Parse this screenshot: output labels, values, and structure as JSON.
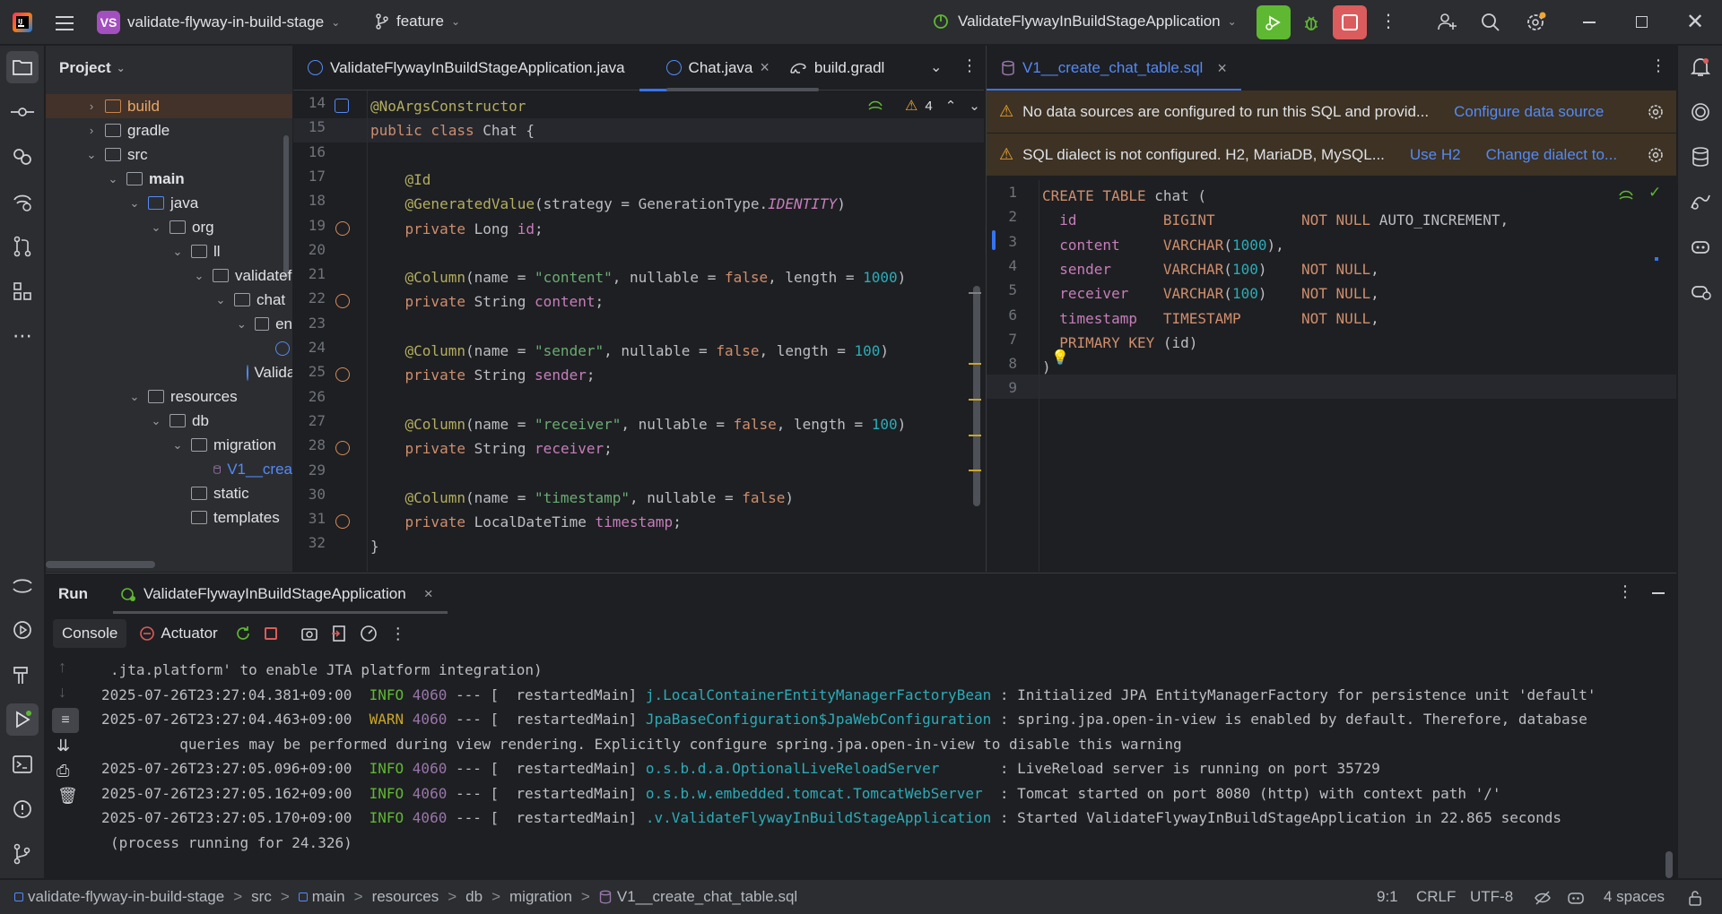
{
  "titlebar": {
    "project_initials": "VS",
    "project_name": "validate-flyway-in-build-stage",
    "branch": "feature",
    "run_config": "ValidateFlywayInBuildStageApplication"
  },
  "project_panel": {
    "title": "Project",
    "tree": [
      {
        "label": "build",
        "depth": 1
      },
      {
        "label": "gradle",
        "depth": 1
      },
      {
        "label": "src",
        "depth": 1
      },
      {
        "label": "main",
        "depth": 2
      },
      {
        "label": "java",
        "depth": 3
      },
      {
        "label": "org",
        "depth": 4
      },
      {
        "label": "ll",
        "depth": 5
      },
      {
        "label": "validatef",
        "depth": 6
      },
      {
        "label": "chat",
        "depth": 7
      },
      {
        "label": "en",
        "depth": 8
      },
      {
        "label": "",
        "depth": 9
      },
      {
        "label": "Valida",
        "depth": 8
      },
      {
        "label": "resources",
        "depth": 3
      },
      {
        "label": "db",
        "depth": 4
      },
      {
        "label": "migration",
        "depth": 5
      },
      {
        "label": "V1__crea",
        "depth": 6
      },
      {
        "label": "static",
        "depth": 4
      },
      {
        "label": "templates",
        "depth": 4
      }
    ]
  },
  "editor_left": {
    "tabs": [
      {
        "label": "ValidateFlywayInBuildStageApplication.java",
        "active": false
      },
      {
        "label": "Chat.java",
        "active": true,
        "close": "×"
      },
      {
        "label": "build.gradl",
        "active": false
      }
    ],
    "warning_count": "4",
    "lines": [
      {
        "n": "14",
        "html": "<span class='ann'>@NoArgsConstructor</span>"
      },
      {
        "n": "15",
        "html": "<span class='kw'>public class</span> <span class='def'>Chat {</span>"
      },
      {
        "n": "16",
        "html": ""
      },
      {
        "n": "17",
        "html": "    <span class='ann'>@Id</span>"
      },
      {
        "n": "18",
        "html": "    <span class='ann'>@GeneratedValue</span><span class='def'>(strategy = GenerationType.</span><span class='it'>IDENTITY</span><span class='def'>)</span>"
      },
      {
        "n": "19",
        "html": "    <span class='kw'>private</span> <span class='def'>Long</span> <span class='fld'>id</span><span class='def'>;</span>"
      },
      {
        "n": "20",
        "html": ""
      },
      {
        "n": "21",
        "html": "    <span class='ann'>@Column</span><span class='def'>(name = </span><span class='str'>\"content\"</span><span class='def'>, nullable = </span><span class='kw'>false</span><span class='def'>, length = </span><span class='num'>1000</span><span class='def'>)</span>"
      },
      {
        "n": "22",
        "html": "    <span class='kw'>private</span> <span class='def'>String</span> <span class='fld'>content</span><span class='def'>;</span>"
      },
      {
        "n": "23",
        "html": ""
      },
      {
        "n": "24",
        "html": "    <span class='ann'>@Column</span><span class='def'>(name = </span><span class='str'>\"sender\"</span><span class='def'>, nullable = </span><span class='kw'>false</span><span class='def'>, length = </span><span class='num'>100</span><span class='def'>)</span>"
      },
      {
        "n": "25",
        "html": "    <span class='kw'>private</span> <span class='def'>String</span> <span class='fld'>sender</span><span class='def'>;</span>"
      },
      {
        "n": "26",
        "html": ""
      },
      {
        "n": "27",
        "html": "    <span class='ann'>@Column</span><span class='def'>(name = </span><span class='str'>\"receiver\"</span><span class='def'>, nullable = </span><span class='kw'>false</span><span class='def'>, length = </span><span class='num'>100</span><span class='def'>)</span>"
      },
      {
        "n": "28",
        "html": "    <span class='kw'>private</span> <span class='def'>String</span> <span class='fld'>receiver</span><span class='def'>;</span>"
      },
      {
        "n": "29",
        "html": ""
      },
      {
        "n": "30",
        "html": "    <span class='ann'>@Column</span><span class='def'>(name = </span><span class='str'>\"timestamp\"</span><span class='def'>, nullable = </span><span class='kw'>false</span><span class='def'>)</span>"
      },
      {
        "n": "31",
        "html": "    <span class='kw'>private</span> <span class='def'>LocalDateTime</span> <span class='fld'>timestamp</span><span class='def'>;</span>"
      },
      {
        "n": "32",
        "html": "<span class='def'>}</span>"
      }
    ]
  },
  "editor_right": {
    "tab_label": "V1__create_chat_table.sql",
    "tab_close": "×",
    "warning1": {
      "text": "No data sources are configured to run this SQL and provid...",
      "action": "Configure data source"
    },
    "warning2": {
      "text": "SQL dialect is not configured. H2, MariaDB, MySQL...",
      "action1": "Use H2",
      "action2": "Change dialect to..."
    },
    "lines": [
      {
        "n": "1",
        "html": "<span class='kw'>CREATE TABLE</span> <span class='def'>chat (</span>"
      },
      {
        "n": "2",
        "html": "  <span class='fld'>id</span>          <span class='kw'>BIGINT</span>          <span class='kw'>NOT NULL</span> <span class='def'>AUTO_INCREMENT,</span>"
      },
      {
        "n": "3",
        "html": "  <span class='fld'>content</span>     <span class='kw'>VARCHAR</span><span class='def'>(</span><span class='num'>1000</span><span class='def'>),</span>"
      },
      {
        "n": "4",
        "html": "  <span class='fld'>sender</span>      <span class='kw'>VARCHAR</span><span class='def'>(</span><span class='num'>100</span><span class='def'>)</span>    <span class='kw'>NOT NULL</span><span class='def'>,</span>"
      },
      {
        "n": "5",
        "html": "  <span class='fld'>receiver</span>    <span class='kw'>VARCHAR</span><span class='def'>(</span><span class='num'>100</span><span class='def'>)</span>    <span class='kw'>NOT NULL</span><span class='def'>,</span>"
      },
      {
        "n": "6",
        "html": "  <span class='fld'>timestamp</span>   <span class='kw'>TIMESTAMP</span>       <span class='kw'>NOT NULL</span><span class='def'>,</span>"
      },
      {
        "n": "7",
        "html": "  <span class='kw'>PRIMARY KEY</span> <span class='def'>(id)</span>"
      },
      {
        "n": "8",
        "html": "<span class='def'>)</span>"
      },
      {
        "n": "9",
        "html": ""
      }
    ]
  },
  "run_panel": {
    "title": "Run",
    "config_tab": "ValidateFlywayInBuildStageApplication",
    "close": "×",
    "console_tab": "Console",
    "actuator_tab": "Actuator",
    "lines": [
      {
        "html": "<span class='def'>.jta.platform' to enable JTA platform integration)</span>"
      },
      {
        "html": "<span class='def'>2025-07-26T23:27:04.381+09:00</span>  <span class='green'>INFO</span> <span class='purple'>4060</span> <span class='def'>--- [  restartedMain]</span> <span class='cyan'>j.LocalContainerEntityManagerFactoryBean</span> <span class='def'>: Initialized JPA EntityManagerFactory for persistence unit 'default'</span>"
      },
      {
        "html": "<span class='def'>2025-07-26T23:27:04.463+09:00</span>  <span class='yellow'>WARN</span> <span class='purple'>4060</span> <span class='def'>--- [  restartedMain]</span> <span class='cyan'>JpaBaseConfiguration$JpaWebConfiguration</span> <span class='def'>: spring.jpa.open-in-view is enabled by default. Therefore, database</span>"
      },
      {
        "html": "<span class='def'>  queries may be performed during view rendering. Explicitly configure spring.jpa.open-in-view to disable this warning</span>"
      },
      {
        "html": "<span class='def'>2025-07-26T23:27:05.096+09:00</span>  <span class='green'>INFO</span> <span class='purple'>4060</span> <span class='def'>--- [  restartedMain]</span> <span class='cyan'>o.s.b.d.a.OptionalLiveReloadServer      </span> <span class='def'>: LiveReload server is running on port 35729</span>"
      },
      {
        "html": "<span class='def'>2025-07-26T23:27:05.162+09:00</span>  <span class='green'>INFO</span> <span class='purple'>4060</span> <span class='def'>--- [  restartedMain]</span> <span class='cyan'>o.s.b.w.embedded.tomcat.TomcatWebServer </span> <span class='def'>: Tomcat started on port 8080 (http) with context path '/'</span>"
      },
      {
        "html": "<span class='def'>2025-07-26T23:27:05.170+09:00</span>  <span class='green'>INFO</span> <span class='purple'>4060</span> <span class='def'>--- [  restartedMain]</span> <span class='cyan'>.v.ValidateFlywayInBuildStageApplication</span> <span class='def'>: Started ValidateFlywayInBuildStageApplication in 22.865 seconds</span>"
      },
      {
        "html": "<span class='def'>(process running for 24.326)</span>"
      }
    ]
  },
  "statusbar": {
    "breadcrumbs": [
      "validate-flyway-in-build-stage",
      "src",
      "main",
      "resources",
      "db",
      "migration",
      "V1__create_chat_table.sql"
    ],
    "sep": ">",
    "position": "9:1",
    "line_endings": "CRLF",
    "encoding": "UTF-8",
    "indent": "4 spaces"
  },
  "colors": {
    "accent": "#3574f0",
    "run_green": "#5fb832",
    "stop_red": "#db5c5c",
    "project_badge": "#a34fbf"
  }
}
